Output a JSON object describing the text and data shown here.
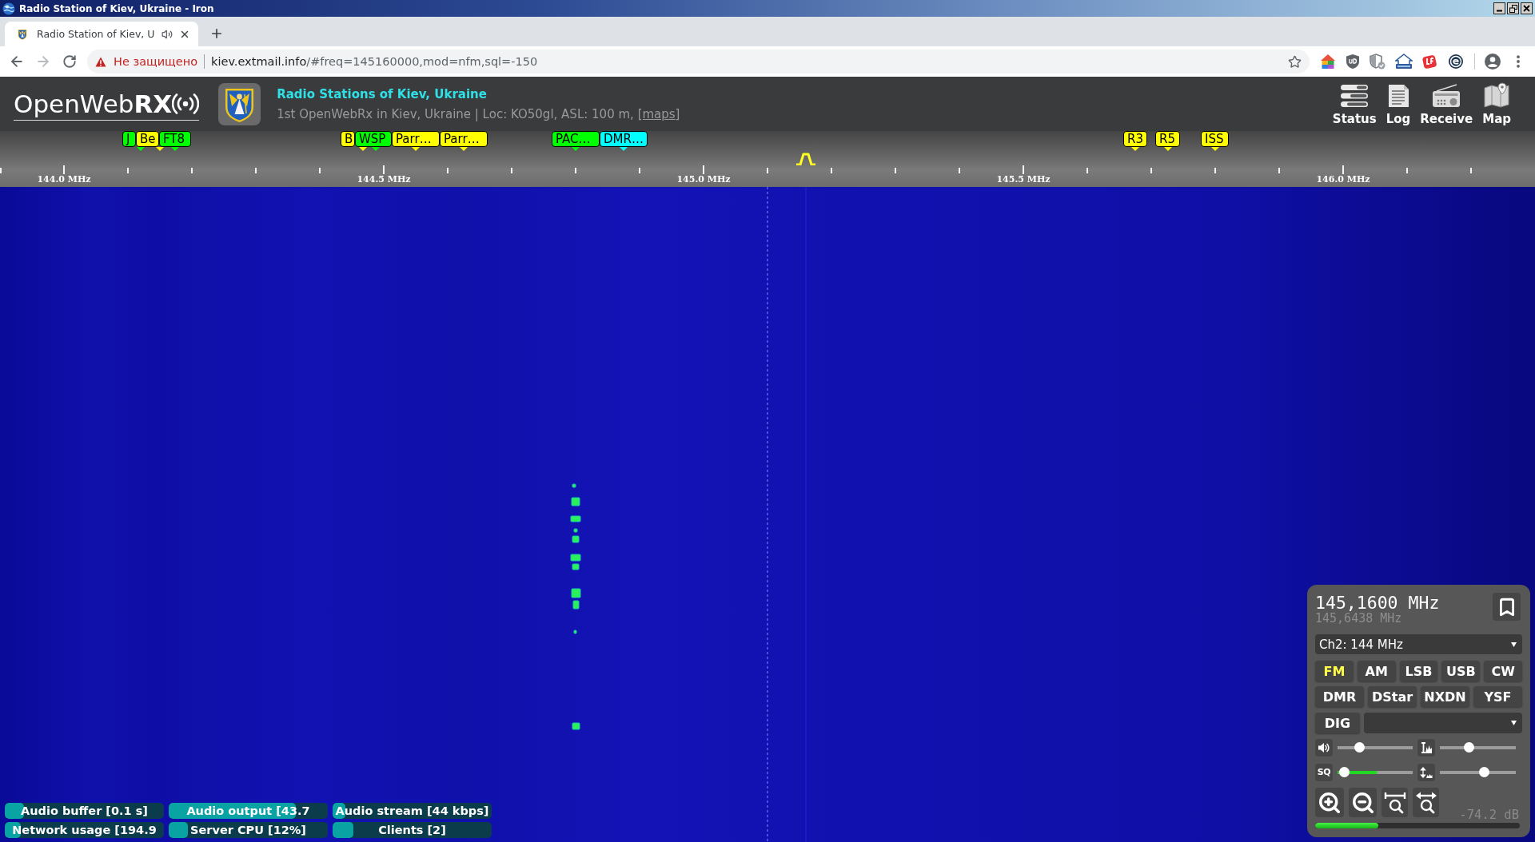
{
  "window": {
    "title": "Radio Station of Kiev, Ukraine - Iron"
  },
  "browser": {
    "tabs": [
      {
        "title": "Radio Station of Kiev, U",
        "selected": true,
        "audio_playing": true
      }
    ],
    "address_bar": {
      "security_warning": "Не защищено",
      "host": "kiev.extmail.info",
      "path": "/#freq=145160000,mod=nfm,sql=-150"
    }
  },
  "header": {
    "logo": "OpenWeb**RX**",
    "title": "Radio Stations of Kiev, Ukraine",
    "description": "1st OpenWebRx in Kiev, Ukraine | Loc: KO50gl, ASL: 100 m,",
    "link": "[maps]",
    "nav": [
      {
        "label": "Status"
      },
      {
        "label": "Log"
      },
      {
        "label": "Receive"
      },
      {
        "label": "Map"
      }
    ]
  },
  "scale": {
    "labels": [
      "144.0 MHz",
      "144.5 MHz",
      "145.0 MHz",
      "145.5 MHz",
      "146.0 MHz"
    ],
    "bookmarks": [
      {
        "label": "J",
        "color": "#00ff00"
      },
      {
        "label": "Be",
        "color": "#ffff00"
      },
      {
        "label": "FT8",
        "color": "#00ff00"
      },
      {
        "label": "B",
        "color": "#ffff00"
      },
      {
        "label": "WSP",
        "color": "#00ff00"
      },
      {
        "label": "Parr…",
        "color": "#ffff00"
      },
      {
        "label": "Parr…",
        "color": "#ffff00"
      },
      {
        "label": "PAC…",
        "color": "#00ff00"
      },
      {
        "label": "DMR…",
        "color": "#00ffff"
      },
      {
        "label": "R3",
        "color": "#ffff00"
      },
      {
        "label": "R5",
        "color": "#ffff00"
      },
      {
        "label": "ISS",
        "color": "#ffff00"
      }
    ]
  },
  "status_bars": [
    {
      "label": "Audio buffer [0.1 s]",
      "level": 0.12
    },
    {
      "label": "Audio output [43.7",
      "level": 0.8
    },
    {
      "label": "Audio stream [44 kbps]",
      "level": 0.08
    },
    {
      "label": "Network usage [194.9",
      "level": 0.1
    },
    {
      "label": "Server CPU [12%]",
      "level": 0.12
    },
    {
      "label": "Clients [2]",
      "level": 0.13
    }
  ],
  "receiver": {
    "frequency": "145,1600 MHz",
    "offset_frequency": "145,6438 MHz",
    "bookmark_select": "Ch2: 144 MHz",
    "mode_rows": [
      [
        {
          "label": "FM",
          "selected": true
        },
        {
          "label": "AM",
          "selected": false
        },
        {
          "label": "LSB",
          "selected": false
        },
        {
          "label": "USB",
          "selected": false
        },
        {
          "label": "CW",
          "selected": false
        }
      ],
      [
        {
          "label": "DMR",
          "selected": false
        },
        {
          "label": "DStar",
          "selected": false
        },
        {
          "label": "NXDN",
          "selected": false
        },
        {
          "label": "YSF",
          "selected": false
        }
      ],
      [
        {
          "label": "DIG",
          "selected": false
        }
      ]
    ],
    "sliders": [
      {
        "level": 0.26
      },
      {
        "level": 0.37
      },
      {
        "label": "SQ",
        "level": 0.03,
        "signal": {
          "level": 0.53
        }
      },
      {
        "level": 0.6
      }
    ],
    "signal_reading": "-74.2 dB",
    "meter": {
      "level": 0.31
    }
  }
}
